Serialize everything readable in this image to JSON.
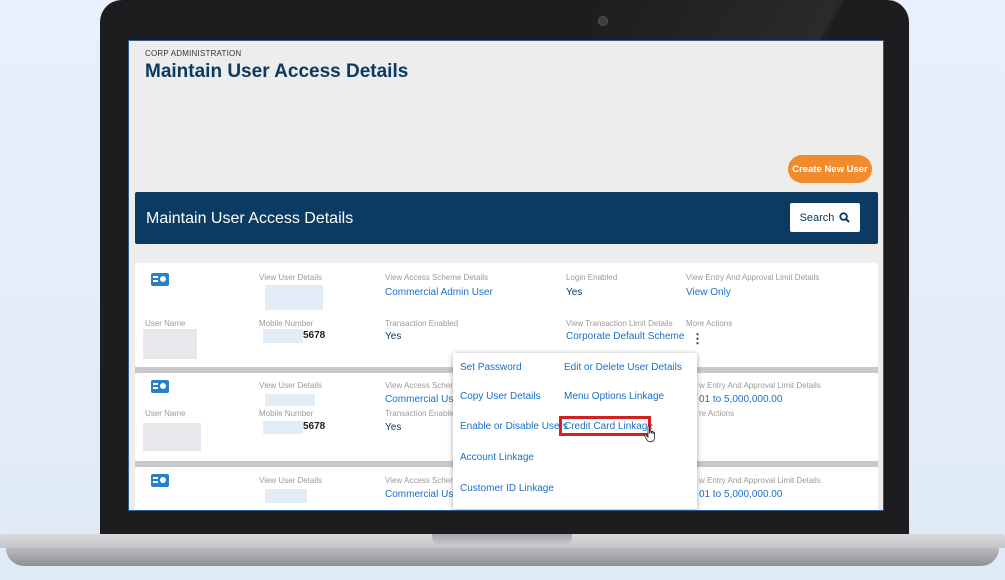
{
  "header": {
    "breadcrumb": "CORP ADMINISTRATION",
    "title": "Maintain User Access Details",
    "create_button": "Create New User"
  },
  "banner": {
    "title": "Maintain User Access Details",
    "search_button": "Search"
  },
  "labels": {
    "view_user_details": "View User Details",
    "view_access_scheme": "View Access Scheme Details",
    "view_access_scheme_cut": "View Access Schem",
    "login_enabled": "Login Enabled",
    "view_entry_limit": "View Entry And Approval Limit Details",
    "view_entry_limit_cut": "w Entry And Approval Limit Details",
    "user_name": "User Name",
    "mobile_number": "Mobile Number",
    "transaction_enabled": "Transaction Enabled",
    "transaction_enabled_cut": "Transaction Enable",
    "view_txn_limit": "View Transaction Limit Details",
    "more_actions": "More Actions",
    "more_actions_cut": "re Actions"
  },
  "rows": [
    {
      "access_scheme": "Commercial Admin User",
      "login_enabled": "Yes",
      "entry_limit": "View Only",
      "mobile": "5678",
      "transaction_enabled": "Yes",
      "txn_limit": "Corporate Default Scheme"
    },
    {
      "access_scheme": "Commercial Use",
      "entry_limit": "01 to 5,000,000.00",
      "mobile": "5678",
      "transaction_enabled": "Yes"
    },
    {
      "access_scheme": "Commercial Use",
      "entry_limit": "01 to 5,000,000.00"
    }
  ],
  "more_actions_menu": {
    "set_password": "Set Password",
    "edit_delete": "Edit or Delete User Details",
    "copy_user": "Copy User Details",
    "menu_options": "Menu Options Linkage",
    "enable_disable": "Enable or Disable Users",
    "credit_card": "Credit Card Linkage",
    "account_linkage": "Account Linkage",
    "customer_id": "Customer ID Linkage"
  },
  "icons": {
    "search": "search-icon",
    "user": "user-card-icon",
    "kebab": "kebab-menu-icon",
    "cursor": "hand-pointer-icon"
  },
  "colors": {
    "navy": "#0b3a63",
    "accent_orange": "#f28b2c",
    "link_blue": "#1a6fc9",
    "highlight_red": "#d42020"
  }
}
